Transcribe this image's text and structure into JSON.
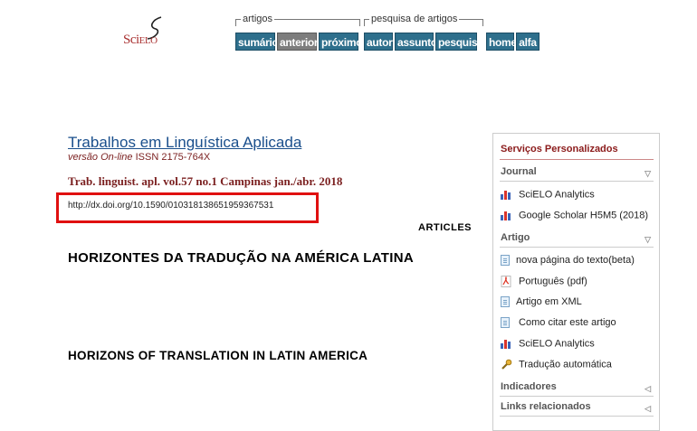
{
  "logo": {
    "text_sci": "Sci",
    "text_elo": "ELO"
  },
  "nav": {
    "groups": [
      {
        "legend": "artigos",
        "buttons": [
          "sumário",
          "anterior",
          "próximo"
        ]
      },
      {
        "legend": "pesquisa de artigos",
        "buttons": [
          "autor",
          "assunto",
          "pesquisa"
        ]
      },
      {
        "legend": "",
        "buttons": [
          "home",
          "alfa"
        ]
      }
    ]
  },
  "article": {
    "journal_title": "Trabalhos em Linguística Aplicada",
    "version_italic": "versão On-line",
    "version_rest": " ISSN 2175-764X",
    "citation": "Trab. linguist. apl. vol.57 no.1 Campinas jan./abr. 2018",
    "doi": "http://dx.doi.org/10.1590/010318138651959367531",
    "section": "ARTICLES",
    "title_pt": "HORIZONTES DA TRADUÇÃO NA AMÉRICA LATINA",
    "title_en": "HORIZONS OF TRANSLATION IN LATIN AMERICA"
  },
  "sidebar": {
    "heading": "Serviços Personalizados",
    "journal": {
      "label": "Journal",
      "items": [
        "SciELO Analytics",
        "Google Scholar H5M5 (2018)"
      ]
    },
    "artigo": {
      "label": "Artigo",
      "items": [
        "nova página do texto(beta)",
        "Português (pdf)",
        "Artigo em XML",
        " Como citar este artigo",
        "SciELO Analytics",
        "Tradução automática"
      ]
    },
    "indicadores": "Indicadores",
    "links": "Links relacionados"
  },
  "colors": {
    "nav_button": "#2e6f8c",
    "nav_disabled": "#7d7d7d",
    "journal_link": "#1a4f8c",
    "citation": "#7a1f1f",
    "doi_highlight": "#e01010"
  }
}
